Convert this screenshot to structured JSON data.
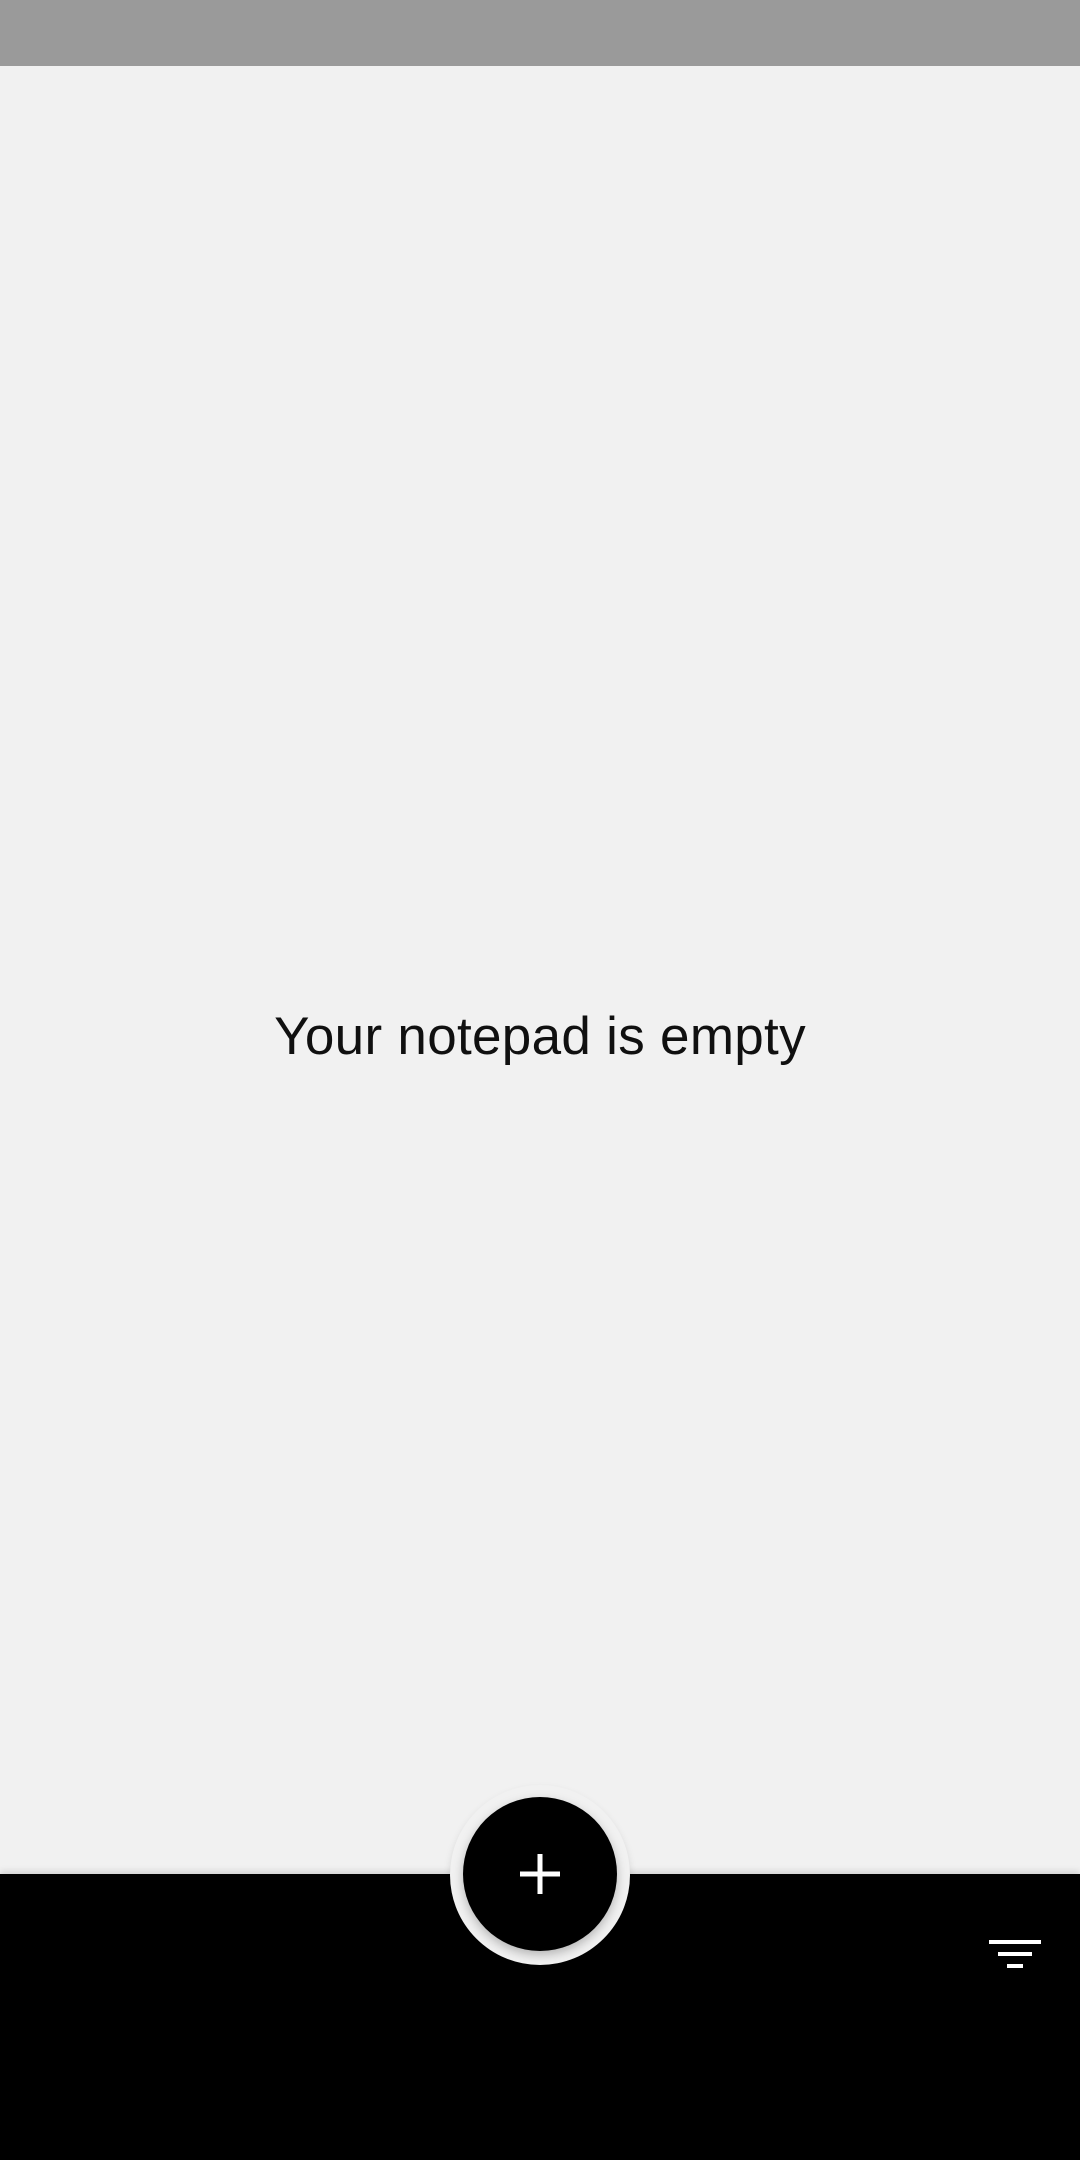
{
  "main": {
    "empty_message": "Your notepad is empty"
  },
  "fab": {
    "icon": "plus-icon"
  },
  "bottom_bar": {
    "filter_icon": "filter-icon"
  },
  "colors": {
    "status_bar": "#9a9a9a",
    "background": "#f1f1f1",
    "bottom_bar": "#000000",
    "fab": "#000000",
    "icon": "#ffffff",
    "text": "#101010"
  }
}
